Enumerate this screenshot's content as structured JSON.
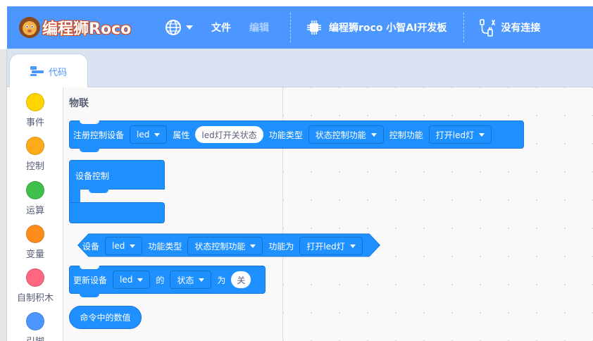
{
  "header": {
    "logo_text": "编程狮Roco",
    "menu": [
      {
        "label": "文件",
        "enabled": true
      },
      {
        "label": "编辑",
        "enabled": false
      }
    ],
    "board_name": "编程狮roco 小智AI开发板",
    "connection_status": "没有连接",
    "icons": [
      "lion-mascot-icon",
      "globe-icon",
      "chip-icon",
      "usb-plug-icon"
    ],
    "accent_color": "#4c97ff"
  },
  "tabs": [
    {
      "label": "代码",
      "active": true
    }
  ],
  "categories": [
    {
      "label": "事件",
      "color": "#ffd500"
    },
    {
      "label": "控制",
      "color": "#ffab19"
    },
    {
      "label": "运算",
      "color": "#40bf4a"
    },
    {
      "label": "变量",
      "color": "#ff8c1a"
    },
    {
      "label": "自制积木",
      "color": "#ff6680"
    },
    {
      "label": "引脚",
      "color": "#4c97ff"
    }
  ],
  "flyout": {
    "title": "物联",
    "block_color": "#1e90ff",
    "blocks": {
      "register": {
        "label": "注册控制设备",
        "device": "led",
        "attr_label": "属性",
        "attr_value": "led灯开关状态",
        "type_label": "功能类型",
        "type_value": "状态控制功能",
        "func_label": "控制功能",
        "func_value": "打开led灯"
      },
      "device_control": {
        "label": "设备控制"
      },
      "device_is": {
        "label": "设备",
        "device": "led",
        "type_label": "功能类型",
        "type_value": "状态控制功能",
        "func_label": "功能为",
        "func_value": "打开led灯"
      },
      "update": {
        "label": "更新设备",
        "device": "led",
        "of_label": "的",
        "field": "状态",
        "to_label": "为",
        "value": "关"
      },
      "cmd_value": {
        "label": "命令中的数值"
      }
    }
  }
}
